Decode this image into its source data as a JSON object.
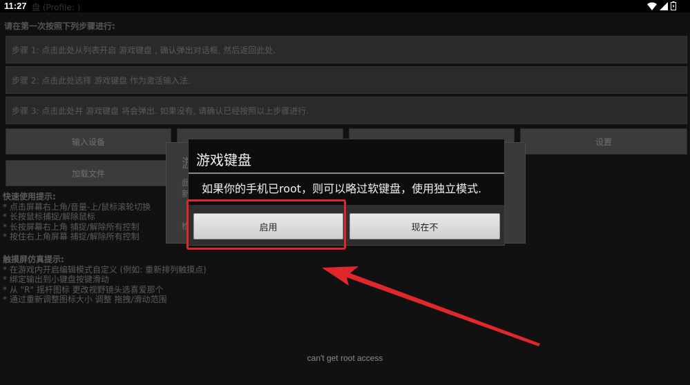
{
  "status": {
    "time": "11:27",
    "ghost_title": "盘 (Profile: )"
  },
  "background": {
    "instruction": "请在第一次按照下列步骤进行:",
    "steps": [
      "步骤 1: 点击此处从列表开启 游戏键盘 , 确认弹出对话框, 然后返回此处.",
      "步骤 2: 点击此处选择 游戏键盘 作为激活输入法.",
      "步骤 3: 点击此处并 游戏键盘 将会弹出. 如果没有, 请确认已经按照以上步骤进行."
    ],
    "buttons_row1": [
      "输入设备",
      "",
      "",
      "设置"
    ],
    "buttons_row2": [
      "加载文件"
    ],
    "tips1": {
      "header": "快速使用提示:",
      "items": [
        "* 点击屏幕右上角/音量-上/鼠标滚轮切换",
        "* 长按鼠标捕捉/解除鼠标",
        "* 长按屏幕右上角 捕捉/解除所有控制",
        "* 按住右上角屏幕 捕捉/解除所有控制"
      ]
    },
    "tips2": {
      "header": "触摸屏仿真提示:",
      "items": [
        "* 在游戏内开启编辑模式自定义 (例如: 重新排列触摸点)",
        "* 绑定输出到小键盘按键滑动",
        "* 从 \"R\" 摇杆图标 更改视野镜头选喜爱那个",
        "* 通过重新调整图标大小 调整 拖拽/滑动范围"
      ]
    },
    "underlying_dialog": {
      "title_fragment": "游",
      "line1": "此",
      "line2": "新",
      "line3": "检"
    }
  },
  "dialog": {
    "title": "游戏键盘",
    "message": "如果你的手机已root，则可以略过软键盘，使用独立模式.",
    "enable_label": "启用",
    "later_label": "现在不"
  },
  "toast": "can't get root access",
  "colors": {
    "annotation": "#e0282b"
  }
}
